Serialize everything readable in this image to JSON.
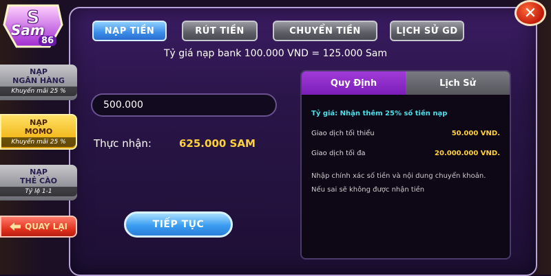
{
  "logo": {
    "text": "Sam",
    "sub": "86"
  },
  "close": {
    "label": "✕"
  },
  "tabs": [
    {
      "label": "NẠP TIỀN",
      "active": true
    },
    {
      "label": "RÚT TIỀN",
      "active": false
    },
    {
      "label": "CHUYỂN TIỀN",
      "active": false
    },
    {
      "label": "LỊCH SỬ GD",
      "active": false
    }
  ],
  "rate_text": "Tỷ giá nạp bank 100.000 VND = 125.000 Sam",
  "sidebar": {
    "items": [
      {
        "line1": "NẠP",
        "line2": "NGÂN HÀNG",
        "promo": "Khuyến mãi 25 %"
      },
      {
        "line1": "NẠP",
        "line2": "MOMO",
        "promo": "Khuyến mãi 25 %"
      },
      {
        "line1": "NẠP",
        "line2": "THẺ CÀO",
        "promo": "Tỷ lệ 1-1"
      }
    ],
    "back_label": "QUAY LẠI"
  },
  "form": {
    "amount_value": "500.000",
    "receive_label": "Thực nhận:",
    "receive_value": "625.000 SAM",
    "continue_label": "TIẾP TỤC"
  },
  "info": {
    "tabs": [
      "Quy Định",
      "Lịch Sử"
    ],
    "highlight": "Tỷ giá: Nhận thêm 25% số tiền nạp",
    "min_label": "Giao dịch tối thiểu",
    "min_value": "50.000 VND.",
    "max_label": "Giao dịch tối đa",
    "max_value": "20.000.000 VND.",
    "note": "Nhập chính xác số tiền và nội dung chuyển khoản. Nếu sai sẽ không được nhận tiền"
  },
  "colors": {
    "accent_gold": "#ffd23a",
    "accent_cyan": "#4de0e8",
    "accent_purple": "#a13bd8"
  }
}
